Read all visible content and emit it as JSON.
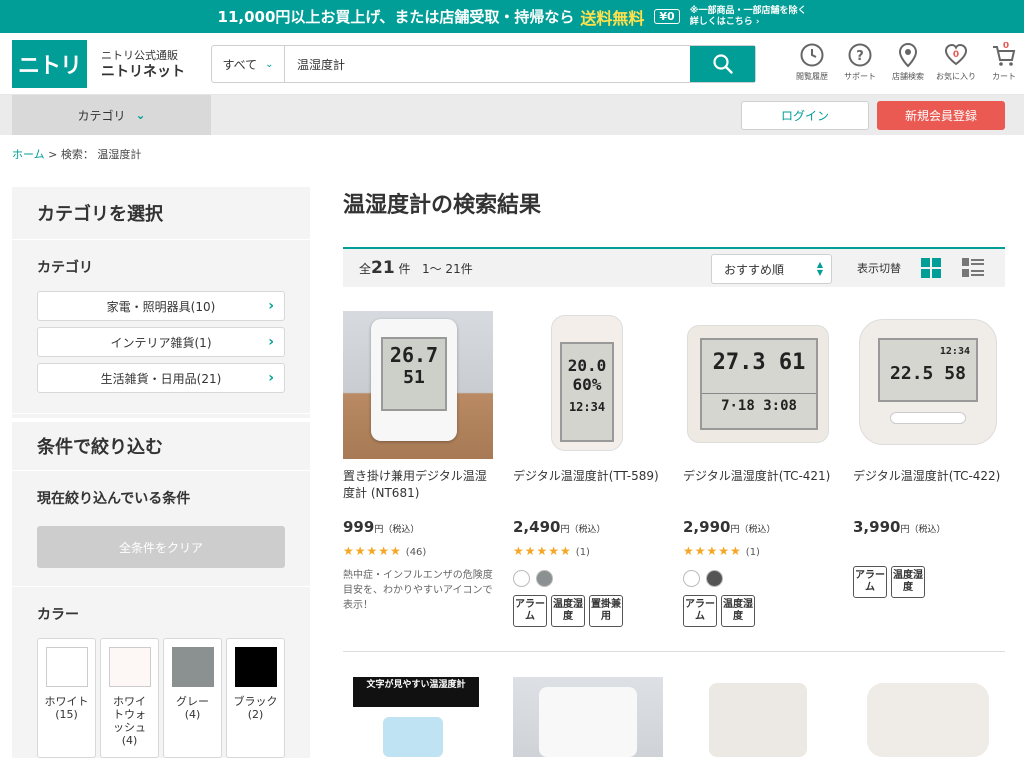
{
  "banner": {
    "amount": "11,000円以上お買上げ、または店舗受取・持帰なら",
    "free": "送料無料",
    "zero": "¥0",
    "note1": "※一部商品・一部店舗を除く",
    "note2": "詳しくはこちら ›"
  },
  "header": {
    "logo": "ニトリ",
    "brand_small": "ニトリ公式通販",
    "brand_name": "ニトリネット",
    "search_scope": "すべて",
    "search_value": "温湿度計",
    "icons": [
      {
        "label": "閲覧履歴"
      },
      {
        "label": "サポート"
      },
      {
        "label": "店舗検索"
      },
      {
        "label": "お気に入り",
        "badge": "0"
      },
      {
        "label": "カート",
        "badge": "0"
      }
    ]
  },
  "nav": {
    "category": "カテゴリ",
    "login": "ログイン",
    "register": "新規会員登録"
  },
  "breadcrumb": {
    "home": "ホーム",
    "sep": " > ",
    "current": "検索： 温湿度計"
  },
  "sidebar": {
    "title": "カテゴリを選択",
    "cat_heading": "カテゴリ",
    "categories": [
      "家電・照明器具(10)",
      "インテリア雑貨(1)",
      "生活雑貨・日用品(21)"
    ],
    "filter_title": "条件で絞り込む",
    "current_heading": "現在絞り込んでいる条件",
    "clear": "全条件をクリア",
    "color_heading": "カラー",
    "colors": [
      {
        "name": "ホワイト",
        "count": "(15)",
        "hex": "#ffffff"
      },
      {
        "name": "ホワイトウォッシュ",
        "count": "(4)",
        "hex": "#fdf8f5"
      },
      {
        "name": "グレー",
        "count": "(4)",
        "hex": "#8a9190"
      },
      {
        "name": "ブラック",
        "count": "(2)",
        "hex": "#000000"
      }
    ]
  },
  "main": {
    "title": "温湿度計の検索結果",
    "count_prefix": "全",
    "count": "21",
    "count_suffix": "件",
    "range": "1～ 21件",
    "sort": "おすすめ順",
    "display": "表示切替",
    "products": [
      {
        "name": "置き掛け兼用デジタル温湿度計 (NT681)",
        "price": "999",
        "yen": "円",
        "tax": "（税込）",
        "stars": "★★★★★",
        "reviews": "(46)",
        "desc": "熱中症・インフルエンザの危険度目安を、わかりやすいアイコンで表示！",
        "lcd1": "26.7",
        "lcd2": "51"
      },
      {
        "name": "デジタル温湿度計(TT-589)",
        "price": "2,490",
        "yen": "円",
        "tax": "（税込）",
        "stars": "★★★★★",
        "reviews": "(1)",
        "tags": [
          "アラーム",
          "温度湿度",
          "置掛兼用"
        ],
        "colors": [
          "#ffffff",
          "#8a9190"
        ],
        "lcd1": "20.0",
        "lcd2": "60%",
        "lcd3": "12:34"
      },
      {
        "name": "デジタル温湿度計(TC-421)",
        "price": "2,990",
        "yen": "円",
        "tax": "（税込）",
        "stars": "★★★★★",
        "reviews": "(1)",
        "tags": [
          "アラーム",
          "温度湿度"
        ],
        "colors": [
          "#ffffff",
          "#555555"
        ],
        "lcd1": "27.3",
        "lcd2": "61",
        "lcd3": "7·18  3:08"
      },
      {
        "name": "デジタル温湿度計(TC-422)",
        "price": "3,990",
        "yen": "円",
        "tax": "（税込）",
        "tags": [
          "アラーム",
          "温度湿度"
        ],
        "lcd1": "22.5",
        "lcd2": "58",
        "lcd3": "12:34"
      }
    ],
    "row2_label": "文字が見やすい温湿度計"
  }
}
